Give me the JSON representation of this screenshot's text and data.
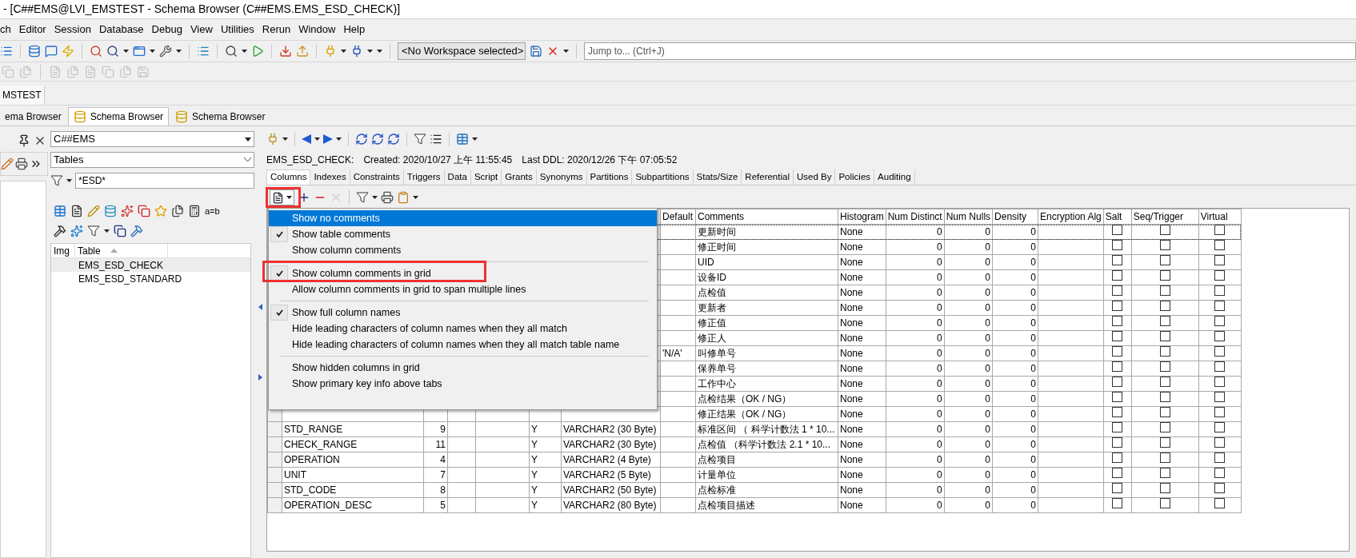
{
  "window": {
    "title": "- [C##EMS@LVI_EMSTEST - Schema Browser (C##EMS.EMS_ESD_CHECK)]"
  },
  "menu_bar": [
    "ch",
    "Editor",
    "Session",
    "Database",
    "Debug",
    "View",
    "Utilities",
    "Rerun",
    "Window",
    "Help"
  ],
  "toolbar": {
    "workspace": "<No Workspace selected>",
    "jump_field": {
      "placeholder": "Jump to... (Ctrl+J)"
    }
  },
  "connection_tabs": [
    {
      "label": "MSTEST",
      "selected": true
    }
  ],
  "document_tabs": [
    {
      "label": "ema Browser",
      "selected": false
    },
    {
      "label": "Schema Browser",
      "selected": true
    },
    {
      "label": "Schema Browser",
      "selected": false
    }
  ],
  "object_panel": {
    "schema": "C##EMS",
    "object_type": "Tables",
    "filter": "*ESD*",
    "compare_label": "a=b",
    "list_columns": [
      "Img",
      "Table"
    ],
    "tables": [
      {
        "name": "EMS_ESD_CHECK",
        "selected": true
      },
      {
        "name": "EMS_ESD_STANDARD",
        "selected": false
      }
    ]
  },
  "details": {
    "summary": [
      "EMS_ESD_CHECK:",
      "Created: 2020/10/27 上午 11:55:45",
      "Last DDL: 2020/12/26 下午 07:05:52"
    ],
    "tabs": [
      {
        "label": "Columns",
        "selected": true
      },
      {
        "label": "Indexes",
        "selected": false
      },
      {
        "label": "Constraints",
        "selected": false
      },
      {
        "label": "Triggers",
        "selected": false
      },
      {
        "label": "Data",
        "selected": false
      },
      {
        "label": "Script",
        "selected": false
      },
      {
        "label": "Grants",
        "selected": false
      },
      {
        "label": "Synonyms",
        "selected": false
      },
      {
        "label": "Partitions",
        "selected": false
      },
      {
        "label": "Subpartitions",
        "selected": false
      },
      {
        "label": "Stats/Size",
        "selected": false
      },
      {
        "label": "Referential",
        "selected": false
      },
      {
        "label": "Used By",
        "selected": false
      },
      {
        "label": "Policies",
        "selected": false
      },
      {
        "label": "Auditing",
        "selected": false
      }
    ],
    "grid": {
      "columns": [
        "Default",
        "Comments",
        "Histogram",
        "Num Distinct",
        "Num Nulls",
        "Density",
        "Encryption Alg",
        "Salt",
        "Seq/Trigger",
        "Virtual"
      ],
      "rows": [
        {
          "focused": true,
          "comments": "更新时间",
          "histogram": "None",
          "num_distinct": "0",
          "num_nulls": "0",
          "density": "0",
          "salt": false,
          "seq_trigger": false,
          "virtual": false
        },
        {
          "focused": false,
          "comments": "修正时间",
          "histogram": "None",
          "num_distinct": "0",
          "num_nulls": "0",
          "density": "0",
          "salt": false,
          "seq_trigger": false,
          "virtual": false
        },
        {
          "focused": false,
          "comments": "UID",
          "histogram": "None",
          "num_distinct": "0",
          "num_nulls": "0",
          "density": "0",
          "salt": false,
          "seq_trigger": false,
          "virtual": false
        },
        {
          "focused": false,
          "comments": "设备ID",
          "histogram": "None",
          "num_distinct": "0",
          "num_nulls": "0",
          "density": "0",
          "salt": false,
          "seq_trigger": false,
          "virtual": false
        },
        {
          "focused": false,
          "comments": "点检值",
          "histogram": "None",
          "num_distinct": "0",
          "num_nulls": "0",
          "density": "0",
          "salt": false,
          "seq_trigger": false,
          "virtual": false
        },
        {
          "focused": false,
          "comments": "更新者",
          "histogram": "None",
          "num_distinct": "0",
          "num_nulls": "0",
          "density": "0",
          "salt": false,
          "seq_trigger": false,
          "virtual": false
        },
        {
          "focused": false,
          "comments": "修正值",
          "histogram": "None",
          "num_distinct": "0",
          "num_nulls": "0",
          "density": "0",
          "salt": false,
          "seq_trigger": false,
          "virtual": false
        },
        {
          "focused": false,
          "comments": "修正人",
          "histogram": "None",
          "num_distinct": "0",
          "num_nulls": "0",
          "density": "0",
          "salt": false,
          "seq_trigger": false,
          "virtual": false
        },
        {
          "focused": false,
          "default": "'N/A'",
          "comments": "叫修单号",
          "histogram": "None",
          "num_distinct": "0",
          "num_nulls": "0",
          "density": "0",
          "salt": false,
          "seq_trigger": false,
          "virtual": false
        },
        {
          "focused": false,
          "comments": "保养单号",
          "histogram": "None",
          "num_distinct": "0",
          "num_nulls": "0",
          "density": "0",
          "salt": false,
          "seq_trigger": false,
          "virtual": false
        },
        {
          "focused": false,
          "comments": "工作中心",
          "histogram": "None",
          "num_distinct": "0",
          "num_nulls": "0",
          "density": "0",
          "salt": false,
          "seq_trigger": false,
          "virtual": false
        },
        {
          "focused": false,
          "comments": "点检结果（OK / NG）",
          "histogram": "None",
          "num_distinct": "0",
          "num_nulls": "0",
          "density": "0",
          "salt": false,
          "seq_trigger": false,
          "virtual": false
        },
        {
          "focused": false,
          "comments": "修正结果（OK / NG）",
          "histogram": "None",
          "num_distinct": "0",
          "num_nulls": "0",
          "density": "0",
          "salt": false,
          "seq_trigger": false,
          "virtual": false
        },
        {
          "focused": false,
          "name": "STD_RANGE",
          "column_id": "9",
          "nullable": "Y",
          "data_type": "VARCHAR2 (30 Byte)",
          "comments": "标准区间 （ 科学计数法 1 * 10...",
          "histogram": "None",
          "num_distinct": "0",
          "num_nulls": "0",
          "density": "0",
          "salt": false,
          "seq_trigger": false,
          "virtual": false
        },
        {
          "focused": false,
          "name": "CHECK_RANGE",
          "column_id": "11",
          "nullable": "Y",
          "data_type": "VARCHAR2 (30 Byte)",
          "comments": "点检值 （科学计数法 2.1 * 10...",
          "histogram": "None",
          "num_distinct": "0",
          "num_nulls": "0",
          "density": "0",
          "salt": false,
          "seq_trigger": false,
          "virtual": false
        },
        {
          "focused": false,
          "name": "OPERATION",
          "column_id": "4",
          "nullable": "Y",
          "data_type": "VARCHAR2 (4 Byte)",
          "comments": "点检项目",
          "histogram": "None",
          "num_distinct": "0",
          "num_nulls": "0",
          "density": "0",
          "salt": false,
          "seq_trigger": false,
          "virtual": false
        },
        {
          "focused": false,
          "name": "UNIT",
          "column_id": "7",
          "nullable": "Y",
          "data_type": "VARCHAR2 (5 Byte)",
          "comments": "计量单位",
          "histogram": "None",
          "num_distinct": "0",
          "num_nulls": "0",
          "density": "0",
          "salt": false,
          "seq_trigger": false,
          "virtual": false
        },
        {
          "focused": false,
          "name": "STD_CODE",
          "column_id": "8",
          "nullable": "Y",
          "data_type": "VARCHAR2 (50 Byte)",
          "comments": "点检标准",
          "histogram": "None",
          "num_distinct": "0",
          "num_nulls": "0",
          "density": "0",
          "salt": false,
          "seq_trigger": false,
          "virtual": false
        },
        {
          "focused": false,
          "name": "OPERATION_DESC",
          "column_id": "5",
          "nullable": "Y",
          "data_type": "VARCHAR2 (80 Byte)",
          "comments": "点检项目描述",
          "histogram": "None",
          "num_distinct": "0",
          "num_nulls": "0",
          "density": "0",
          "salt": false,
          "seq_trigger": false,
          "virtual": false
        }
      ]
    },
    "comments_menu": {
      "items": [
        {
          "kind": "item",
          "label": "Show no comments",
          "checked": false,
          "highlighted": true
        },
        {
          "kind": "item",
          "label": "Show table comments",
          "checked": true,
          "highlighted": false
        },
        {
          "kind": "item",
          "label": "Show column comments",
          "checked": false,
          "highlighted": false
        },
        {
          "kind": "separator"
        },
        {
          "kind": "item",
          "label": "Show column comments in grid",
          "checked": true,
          "highlighted": false
        },
        {
          "kind": "item",
          "label": "Allow column comments in grid to span multiple lines",
          "checked": false,
          "highlighted": false
        },
        {
          "kind": "separator"
        },
        {
          "kind": "item",
          "label": "Show full column names",
          "checked": true,
          "highlighted": false
        },
        {
          "kind": "item",
          "label": "Hide leading characters of column names when they all match",
          "checked": false,
          "highlighted": false
        },
        {
          "kind": "item",
          "label": "Hide leading characters of column names when they all match table name",
          "checked": false,
          "highlighted": false
        },
        {
          "kind": "separator"
        },
        {
          "kind": "item",
          "label": "Show hidden columns in grid",
          "checked": false,
          "highlighted": false
        },
        {
          "kind": "item",
          "label": "Show primary key info above tabs",
          "checked": false,
          "highlighted": false
        }
      ]
    }
  }
}
